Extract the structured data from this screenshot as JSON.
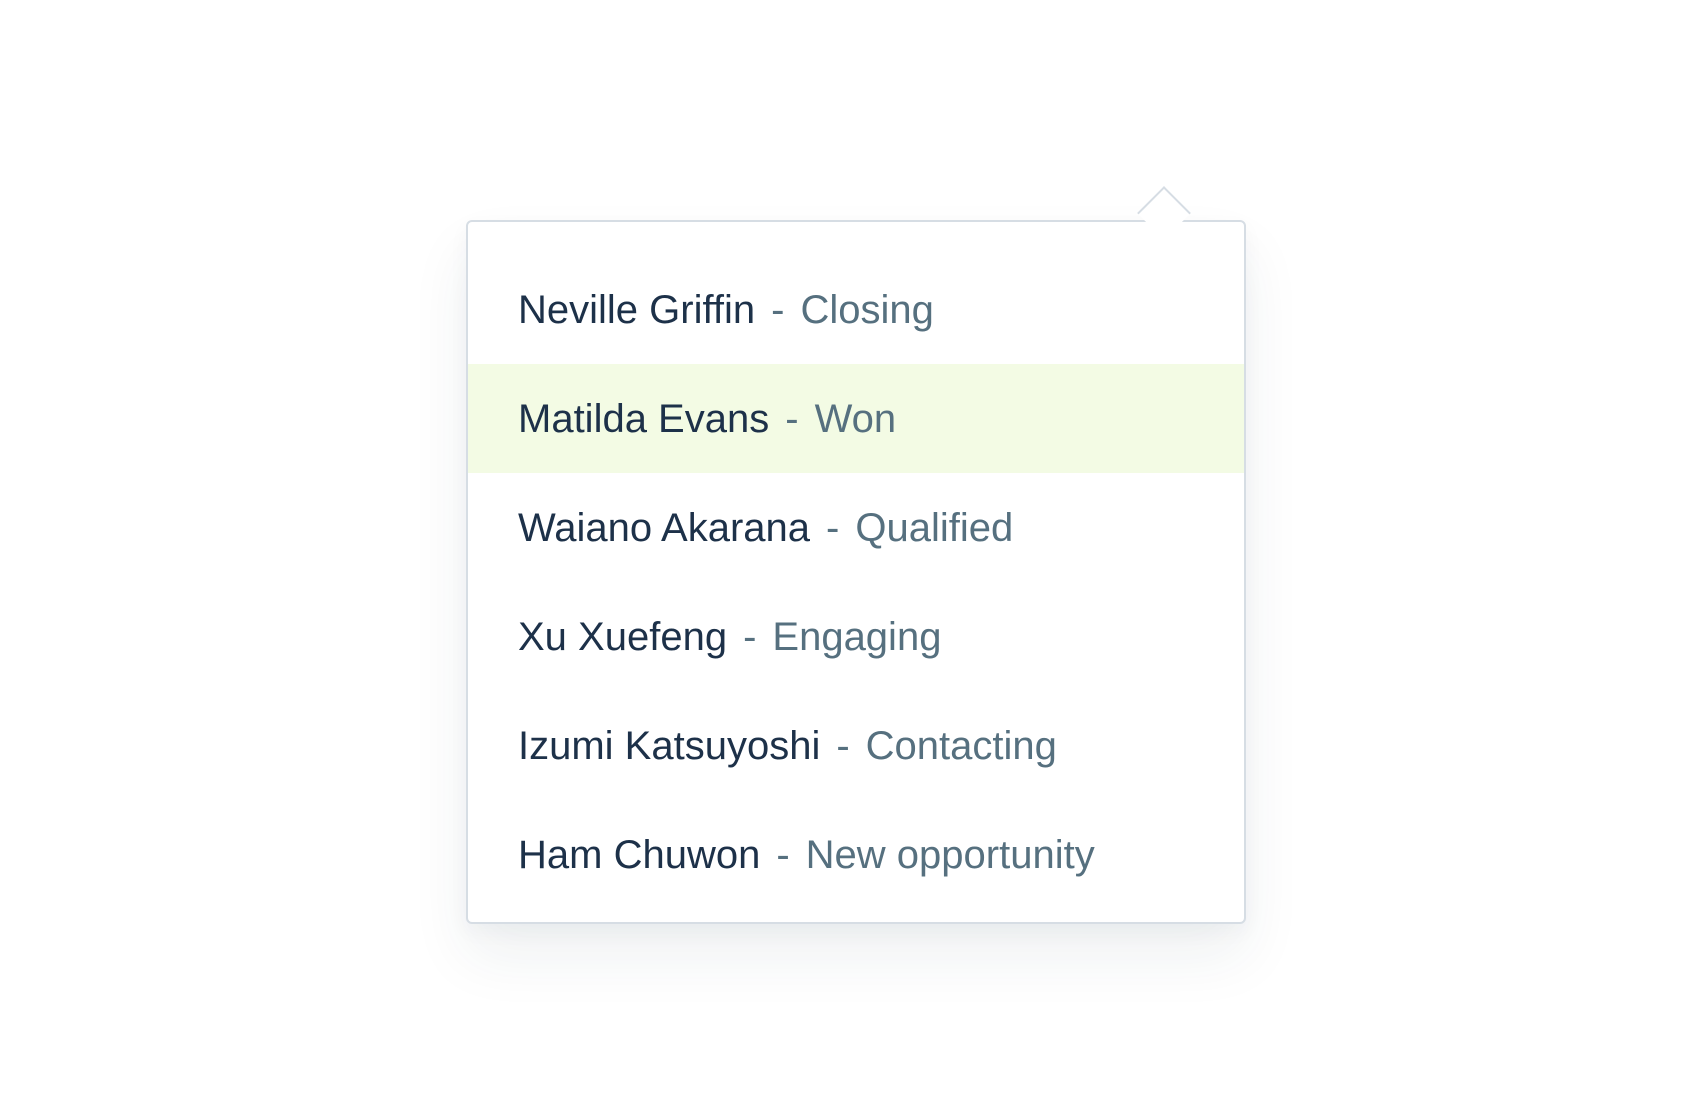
{
  "colors": {
    "name_text": "#1d3149",
    "status_text": "#56707f",
    "highlight_bg": "#f3fbe4",
    "border": "#d6dde4"
  },
  "dropdown": {
    "separator": "-",
    "highlighted_index": 1,
    "items": [
      {
        "name": "Neville Griffin",
        "stage": "Closing"
      },
      {
        "name": "Matilda Evans",
        "stage": "Won"
      },
      {
        "name": "Waiano Akarana",
        "stage": "Qualified"
      },
      {
        "name": "Xu Xuefeng",
        "stage": "Engaging"
      },
      {
        "name": "Izumi Katsuyoshi",
        "stage": "Contacting"
      },
      {
        "name": "Ham Chuwon",
        "stage": "New opportunity"
      }
    ]
  }
}
